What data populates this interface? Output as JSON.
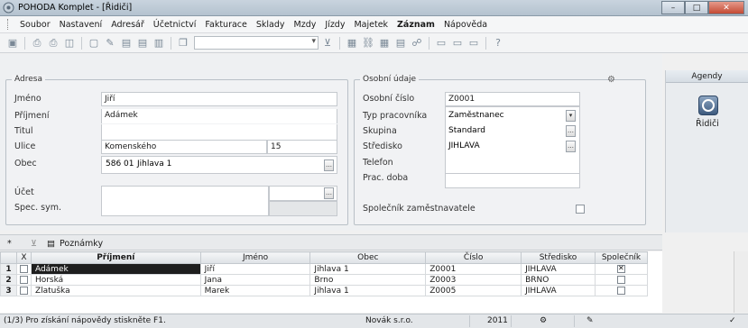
{
  "window": {
    "title": "POHODA Komplet - [Řidiči]",
    "min": "–",
    "max": "□",
    "close": "✕"
  },
  "menu": [
    {
      "label": "Soubor",
      "bold": false
    },
    {
      "label": "Nastavení",
      "bold": false
    },
    {
      "label": "Adresář",
      "bold": false
    },
    {
      "label": "Účetnictví",
      "bold": false
    },
    {
      "label": "Fakturace",
      "bold": false
    },
    {
      "label": "Sklady",
      "bold": false
    },
    {
      "label": "Mzdy",
      "bold": false
    },
    {
      "label": "Jízdy",
      "bold": false
    },
    {
      "label": "Majetek",
      "bold": false
    },
    {
      "label": "Záznam",
      "bold": true
    },
    {
      "label": "Nápověda",
      "bold": false
    }
  ],
  "adresa": {
    "legend": "Adresa",
    "jmeno_label": "Jméno",
    "jmeno": "Jiří",
    "prijmeni_label": "Příjmení",
    "prijmeni": "Adámek",
    "titul_label": "Titul",
    "titul": "",
    "ulice_label": "Ulice",
    "ulice": "Komenského",
    "cislo": "15",
    "obec_label": "Obec",
    "psc": "586 01",
    "obec": "Jihlava 1",
    "ucet_label": "Účet",
    "ucet": "",
    "spec_label": "Spec. sym.",
    "spec": ""
  },
  "osobni": {
    "legend": "Osobní údaje",
    "cislo_label": "Osobní číslo",
    "cislo": "Z0001",
    "typ_label": "Typ pracovníka",
    "typ": "Zaměstnanec",
    "skupina_label": "Skupina",
    "skupina": "Standard",
    "stredisko_label": "Středisko",
    "stredisko": "JIHLAVA",
    "telefon_label": "Telefon",
    "telefon": "",
    "doba_label": "Prac. doba",
    "doba": "",
    "spolecnik_label": "Společník zaměstnavatele"
  },
  "agenda": {
    "header": "Agendy",
    "item": "Řidiči"
  },
  "tabs": {
    "star": "*",
    "filter": "⊻",
    "notes": "Poznámky"
  },
  "grid": {
    "headers": [
      "X",
      "Příjmení",
      "Jméno",
      "Obec",
      "Číslo",
      "Středisko",
      "Společník"
    ],
    "rows": [
      {
        "n": "1",
        "prijmeni": "Adámek",
        "jmeno": "Jiří",
        "obec": "Jihlava 1",
        "cislo": "Z0001",
        "stredisko": "JIHLAVA",
        "spolecnik": true,
        "selected": true
      },
      {
        "n": "2",
        "prijmeni": "Horská",
        "jmeno": "Jana",
        "obec": "Brno",
        "cislo": "Z0003",
        "stredisko": "BRNO",
        "spolecnik": false,
        "selected": false
      },
      {
        "n": "3",
        "prijmeni": "Zlatuška",
        "jmeno": "Marek",
        "obec": "Jihlava 1",
        "cislo": "Z0005",
        "stredisko": "JIHLAVA",
        "spolecnik": false,
        "selected": false
      }
    ]
  },
  "status": {
    "help": "(1/3) Pro získání nápovědy stiskněte F1.",
    "company": "Novák s.r.o.",
    "year": "2011"
  }
}
